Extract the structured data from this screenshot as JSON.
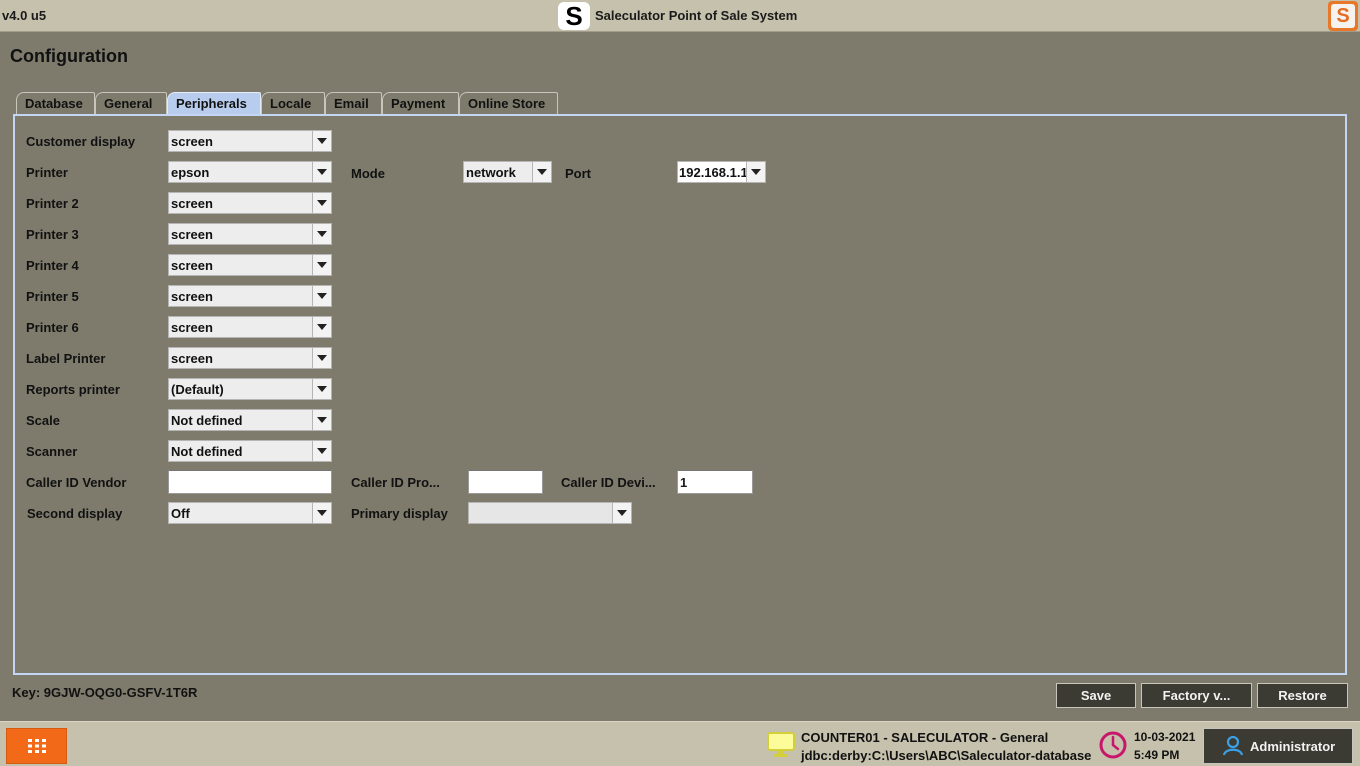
{
  "titlebar": {
    "version": "v4.0 u5",
    "logo_letter": "S",
    "app_title": "Saleculator Point of Sale System",
    "corner_logo_letter": "S"
  },
  "page": {
    "title": "Configuration"
  },
  "tabs": [
    {
      "label": "Database",
      "active": false
    },
    {
      "label": "General",
      "active": false
    },
    {
      "label": "Peripherals",
      "active": true
    },
    {
      "label": "Locale",
      "active": false
    },
    {
      "label": "Email",
      "active": false
    },
    {
      "label": "Payment",
      "active": false
    },
    {
      "label": "Online Store",
      "active": false
    }
  ],
  "peripherals": {
    "customer_display": {
      "label": "Customer display",
      "value": "screen"
    },
    "printer": {
      "label": "Printer",
      "value": "epson"
    },
    "mode": {
      "label": "Mode",
      "value": "network"
    },
    "port": {
      "label": "Port",
      "value": "192.168.1.1"
    },
    "printer2": {
      "label": "Printer 2",
      "value": "screen"
    },
    "printer3": {
      "label": "Printer 3",
      "value": "screen"
    },
    "printer4": {
      "label": "Printer 4",
      "value": "screen"
    },
    "printer5": {
      "label": "Printer 5",
      "value": "screen"
    },
    "printer6": {
      "label": "Printer 6",
      "value": "screen"
    },
    "label_printer": {
      "label": "Label Printer",
      "value": "screen"
    },
    "reports_printer": {
      "label": "Reports printer",
      "value": "(Default)"
    },
    "scale": {
      "label": "Scale",
      "value": "Not defined"
    },
    "scanner": {
      "label": "Scanner",
      "value": "Not defined"
    },
    "caller_id_vendor": {
      "label": "Caller ID Vendor",
      "value": ""
    },
    "caller_id_product": {
      "label": "Caller ID Pro...",
      "value": ""
    },
    "caller_id_device": {
      "label": "Caller ID Devi...",
      "value": "1"
    },
    "second_display": {
      "label": "Second display",
      "value": "Off"
    },
    "primary_display": {
      "label": "Primary display",
      "value": ""
    }
  },
  "footer": {
    "key_text": "Key: 9GJW-OQG0-GSFV-1T6R",
    "save_label": "Save",
    "factory_label": "Factory v...",
    "restore_label": "Restore"
  },
  "statusbar": {
    "host": "COUNTER01 - SALECULATOR - General",
    "db": "jdbc:derby:C:\\Users\\ABC\\Saleculator-database",
    "date": "10-03-2021",
    "time": "5:49 PM",
    "user": "Administrator"
  },
  "colors": {
    "background": "#7e7b6c",
    "titlebar": "#c5c1ad",
    "active_tab": "#b8ccee",
    "button_dark": "#3c3b33",
    "menu_orange": "#f26a17",
    "clock_pink": "#c8166b",
    "monitor_yellow": "#e8e84a",
    "user_blue": "#3aa0e8"
  }
}
